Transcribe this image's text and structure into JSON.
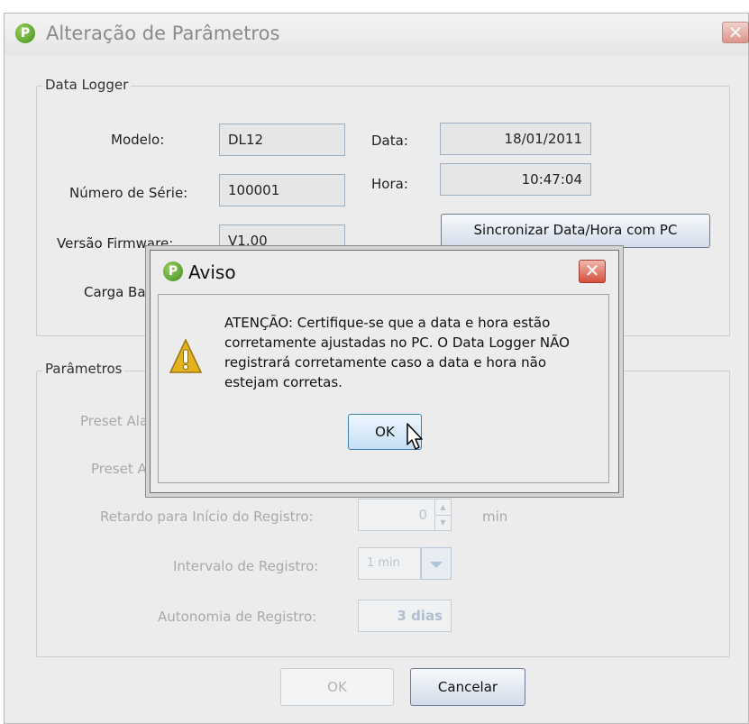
{
  "window": {
    "title": "Alteração de Parâmetros",
    "close_glyph": "✕",
    "icon": "app-logo-icon"
  },
  "data_logger": {
    "group_title": "Data Logger",
    "modelo_label": "Modelo:",
    "modelo_value": "DL12",
    "serie_label": "Número de Série:",
    "serie_value": "100001",
    "firmware_label": "Versão Firmware:",
    "firmware_value": "V1.00",
    "carga_label": "Carga Ba",
    "data_label": "Data:",
    "data_value": "18/01/2011",
    "hora_label": "Hora:",
    "hora_value": "10:47:04",
    "sync_button": "Sincronizar Data/Hora com PC"
  },
  "parametros": {
    "group_title": "Parâmetros",
    "preset_alarme_1_label": "Preset Ala",
    "preset_alarme_2_label": "Preset A",
    "retardo_label": "Retardo para Início do Registro:",
    "retardo_value": "0",
    "retardo_unit": "min",
    "intervalo_label": "Intervalo de Registro:",
    "intervalo_value": "1 min",
    "autonomia_label": "Autonomia de Registro:",
    "autonomia_value": "3 dias"
  },
  "footer": {
    "ok_button": "OK",
    "cancel_button": "Cancelar"
  },
  "dialog": {
    "title": "Aviso",
    "close_glyph": "✕",
    "icon": "warning-icon",
    "message_lines": [
      "ATENÇÃO: Certifique-se que a data e hora estão",
      "corretamente ajustadas no PC. O Data Logger NÃO",
      "registrará corretamente caso a data e hora não",
      "estejam corretas."
    ],
    "ok_button": "OK"
  },
  "colors": {
    "accent_green": "#3e8f1e",
    "close_red": "#d4503f",
    "warning_yellow": "#e3b21c"
  }
}
